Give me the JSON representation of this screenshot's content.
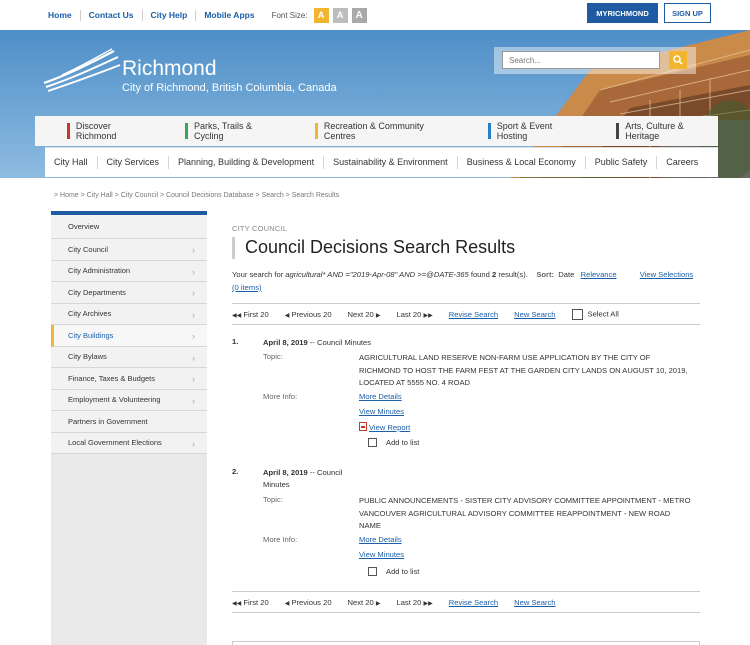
{
  "topbar": {
    "links": [
      "Home",
      "Contact Us",
      "City Help",
      "Mobile Apps"
    ],
    "font_size_label": "Font Size:",
    "font_buttons": [
      "A",
      "A",
      "A"
    ],
    "myrichmond": "MYRICHMOND",
    "signup": "SIGN UP"
  },
  "banner": {
    "logo_name": "Richmond",
    "logo_sub": "City of Richmond, British Columbia, Canada",
    "search_placeholder": "Search..."
  },
  "primary_nav": [
    {
      "label": "Discover Richmond",
      "color": "#c8372d"
    },
    {
      "label": "Parks, Trails & Cycling",
      "color": "#3aa35a"
    },
    {
      "label": "Recreation & Community Centres",
      "color": "#f2b530"
    },
    {
      "label": "Sport & Event Hosting",
      "color": "#2a7fc1"
    },
    {
      "label": "Arts, Culture & Heritage",
      "color": "#444444"
    }
  ],
  "secondary_nav": [
    "City Hall",
    "City Services",
    "Planning, Building & Development",
    "Sustainability & Environment",
    "Business & Local Economy",
    "Public Safety",
    "Careers"
  ],
  "breadcrumb": "> Home > City Hall > City Council > Council Decisions Database > Search > Search Results",
  "sidebar": {
    "items": [
      "Overview",
      "City Council",
      "City Administration",
      "City Departments",
      "City Archives",
      "City Buildings",
      "City Bylaws",
      "Finance, Taxes & Budgets",
      "Employment & Volunteering",
      "Partners in Government",
      "Local Government Elections"
    ],
    "active": "City Buildings"
  },
  "main": {
    "section": "CITY COUNCIL",
    "title": "Council Decisions Search Results",
    "summary_pre": "Your search for ",
    "summary_query": "agricultural* AND =\"2019-Apr-08\" AND >=@DATE-365",
    "summary_found": " found ",
    "summary_count": "2",
    "summary_results": " result(s).",
    "sort_label": "Sort:",
    "sort_date": "Date",
    "sort_relevance": "Relevance",
    "view_selections": "View Selections (0 items)"
  },
  "pager": {
    "first": "First 20",
    "previous": "Previous 20",
    "next": "Next 20",
    "last": "Last 20",
    "revise": "Revise Search",
    "new_search": "New Search",
    "select_all": "Select All"
  },
  "results": [
    {
      "num": "1.",
      "date": "April 8, 2019",
      "type": "-- Council Minutes",
      "topic_label": "Topic:",
      "topic": "AGRICULTURAL LAND RESERVE NON-FARM USE APPLICATION BY THE CITY OF RICHMOND TO HOST THE FARM FEST AT THE GARDEN CITY LANDS ON AUGUST 10, 2019, LOCATED AT 5555 NO. 4 ROAD",
      "more_label": "More Info:",
      "more_details": "More Details",
      "view_minutes": "View Minutes",
      "view_report": "View Report",
      "add_to_list": "Add to list"
    },
    {
      "num": "2.",
      "date": "April 8, 2019",
      "type": "-- Council Minutes",
      "topic_label": "Topic:",
      "topic": "PUBLIC ANNOUNCEMENTS - SISTER CITY ADVISORY COMMITTEE APPOINTMENT - METRO VANCOUVER AGRICULTURAL ADVISORY COMMITTEE REAPPOINTMENT - NEW ROAD NAME",
      "more_label": "More Info:",
      "more_details": "More Details",
      "view_minutes": "View Minutes",
      "add_to_list": "Add to list"
    }
  ]
}
